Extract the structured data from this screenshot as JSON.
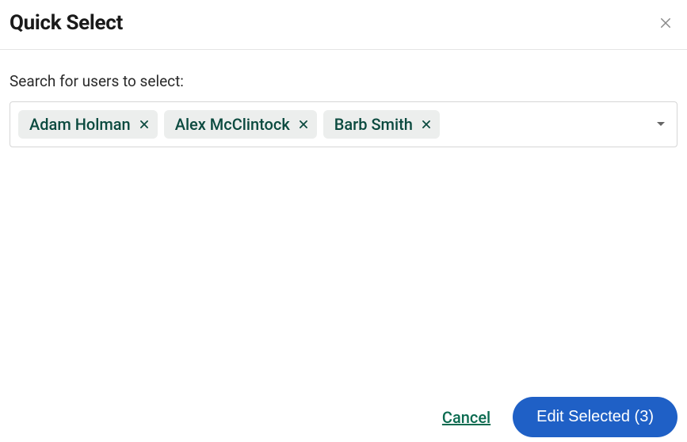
{
  "header": {
    "title": "Quick Select"
  },
  "search": {
    "label": "Search for users to select:",
    "chips": [
      {
        "name": "Adam Holman"
      },
      {
        "name": "Alex McClintock"
      },
      {
        "name": "Barb Smith"
      }
    ]
  },
  "footer": {
    "cancel_label": "Cancel",
    "edit_label": "Edit Selected (3)"
  }
}
